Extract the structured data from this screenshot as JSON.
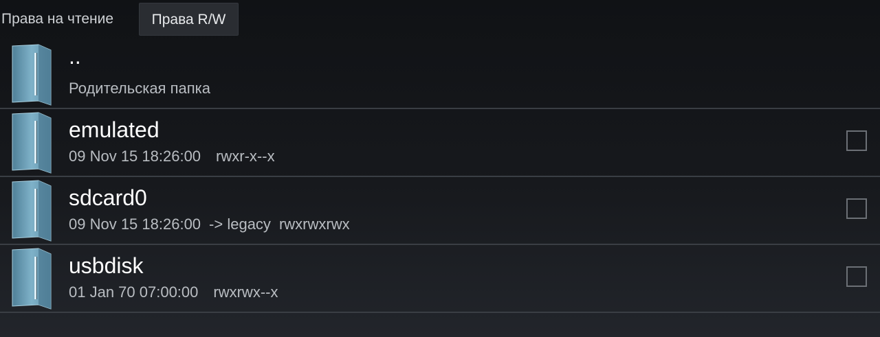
{
  "tabs": {
    "read_label": "Права на чтение",
    "rw_label": "Права R/W"
  },
  "rows": [
    {
      "name": "..",
      "subtitle": "Родительская папка",
      "icon": "folder-icon"
    },
    {
      "name": "emulated",
      "date": "09 Nov 15 18:26:00",
      "link": "",
      "perms": "rwxr-x--x",
      "icon": "folder-icon",
      "checked": false
    },
    {
      "name": "sdcard0",
      "date": "09 Nov 15 18:26:00",
      "link": "-> legacy",
      "perms": "rwxrwxrwx",
      "icon": "folder-icon",
      "checked": false
    },
    {
      "name": "usbdisk",
      "date": "01 Jan 70 07:00:00",
      "link": "",
      "perms": "rwxrwx--x",
      "icon": "folder-icon",
      "checked": false
    }
  ],
  "colors": {
    "background": "#15171b",
    "divider": "#3a3e44",
    "folder": "#6fa3bd"
  }
}
